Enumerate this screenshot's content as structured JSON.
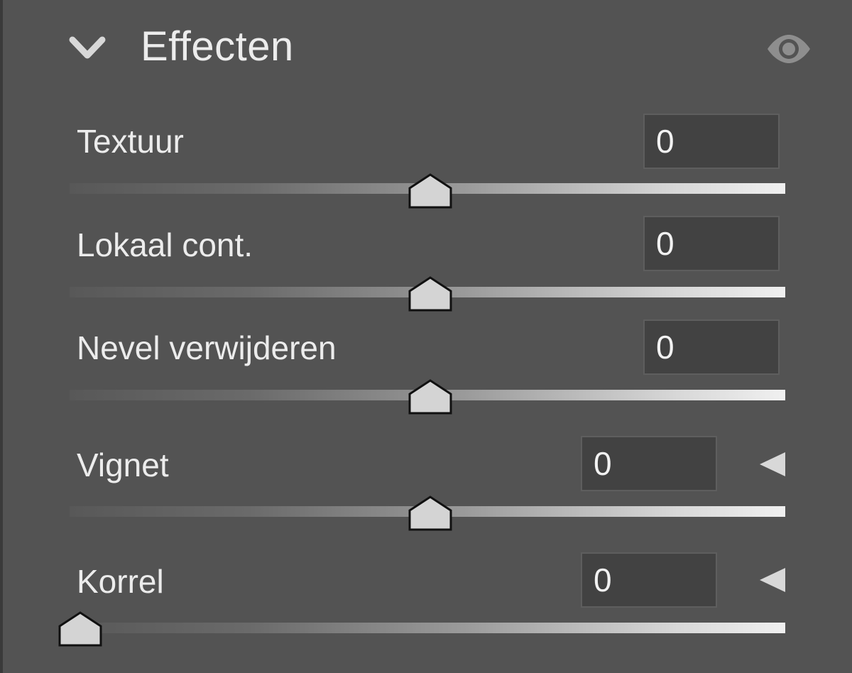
{
  "panel": {
    "title": "Effecten",
    "collapse_icon": "chevron-down-icon",
    "visibility_icon": "eye-icon"
  },
  "sliders": [
    {
      "label": "Textuur",
      "value": "0",
      "min": -100,
      "max": 100,
      "level": 0,
      "has_reset": false
    },
    {
      "label": "Lokaal cont.",
      "value": "0",
      "min": -100,
      "max": 100,
      "level": 0,
      "has_reset": false
    },
    {
      "label": "Nevel verwijderen",
      "value": "0",
      "min": -100,
      "max": 100,
      "level": 0,
      "has_reset": false
    },
    {
      "label": "Vignet",
      "value": "0",
      "min": -100,
      "max": 100,
      "level": 0,
      "has_reset": true
    },
    {
      "label": "Korrel",
      "value": "0",
      "min": 0,
      "max": 100,
      "level": 0,
      "has_reset": true
    }
  ],
  "colors": {
    "background": "#535353",
    "text": "#ececec",
    "input_bg": "#424242",
    "thumb_fill": "#d4d4d4"
  }
}
